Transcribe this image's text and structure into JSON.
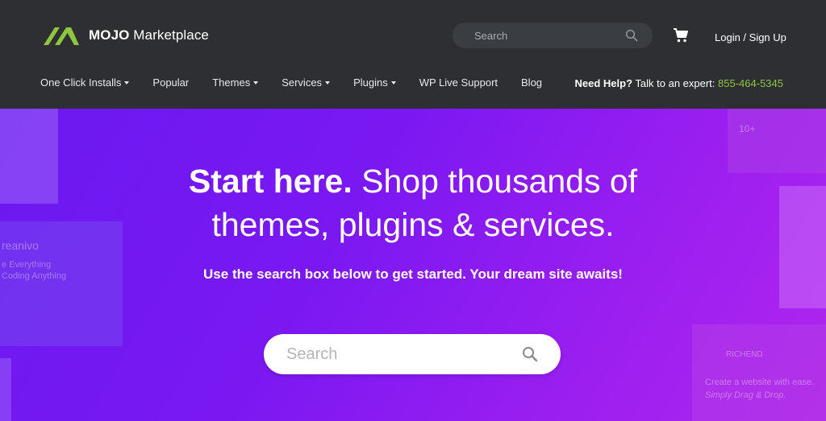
{
  "brand": {
    "name_bold": "MOJO",
    "name_rest": " Marketplace",
    "accent": "#8dc63f"
  },
  "header": {
    "search_placeholder": "Search",
    "login_label": "Login / Sign Up"
  },
  "nav": {
    "items": [
      {
        "label": "One Click Installs",
        "dropdown": true
      },
      {
        "label": "Popular",
        "dropdown": false
      },
      {
        "label": "Themes",
        "dropdown": true
      },
      {
        "label": "Services",
        "dropdown": true
      },
      {
        "label": "Plugins",
        "dropdown": true
      },
      {
        "label": "WP Live Support",
        "dropdown": false
      },
      {
        "label": "Blog",
        "dropdown": false
      }
    ]
  },
  "help": {
    "bold": "Need Help?",
    "text": " Talk to an expert: ",
    "phone": "855-464-5345"
  },
  "hero": {
    "headline_bold": "Start here.",
    "headline_rest": " Shop thousands of",
    "headline_line2": "themes, plugins & services.",
    "subline": "Use the search box below to get started. Your dream site awaits!",
    "search_placeholder": "Search",
    "deco": {
      "left_logo": "reanivo",
      "left_line1": "e Everything",
      "left_line2": "Coding Anything",
      "right_count": "10+",
      "right_brand": "RICHEND",
      "right_line1": "Create a website with ease.",
      "right_line2": "Simply Drag & Drop."
    }
  },
  "colors": {
    "header_bg": "#2d2f32",
    "hero_start": "#6a19f0",
    "hero_end": "#b026ee"
  }
}
